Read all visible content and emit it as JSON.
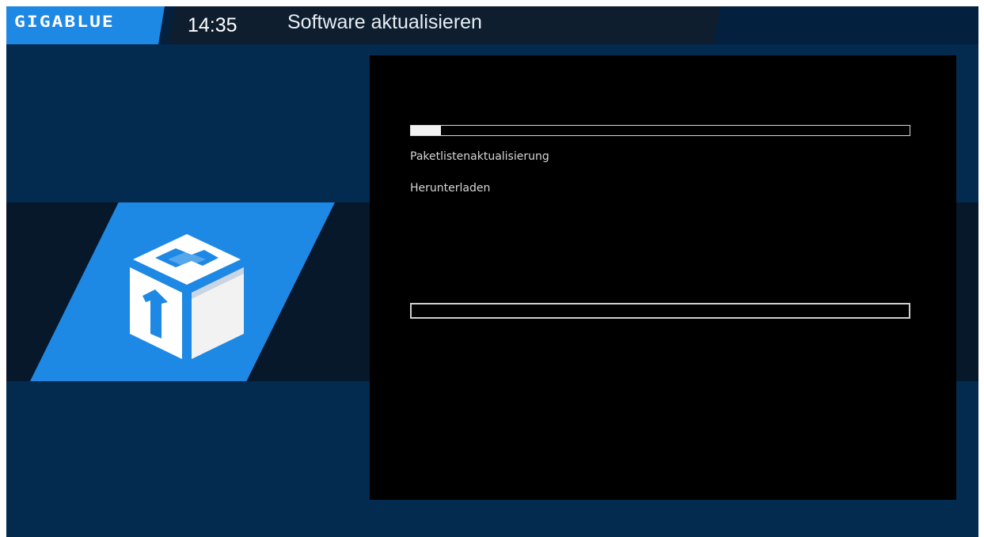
{
  "header": {
    "brand": "GIGABLUE",
    "time": "14:35",
    "title": "Software aktualisieren"
  },
  "icon": {
    "name": "software-update-package-icon"
  },
  "update": {
    "progress_fraction": 0.06,
    "secondary_progress_fraction": 0,
    "status_lines": [
      "Paketlistenaktualisierung",
      "Herunterladen"
    ]
  },
  "colors": {
    "background": "#032a4f",
    "accent": "#1e88e5",
    "panel": "#000000"
  }
}
